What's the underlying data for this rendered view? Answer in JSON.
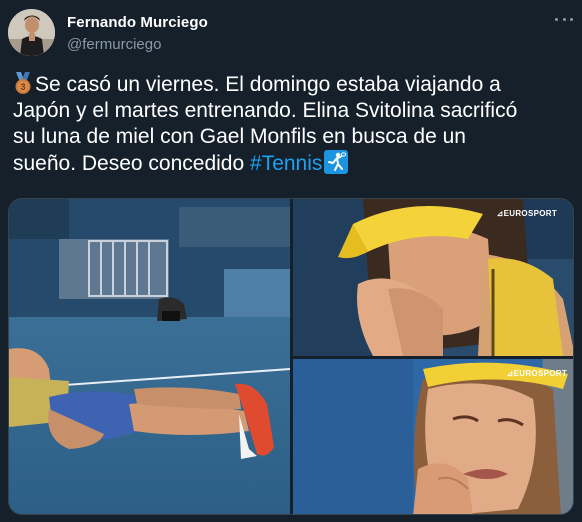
{
  "author": {
    "display_name": "Fernando Murciego",
    "handle": "@fermurciego"
  },
  "menu": {
    "icon": "more-horizontal-icon"
  },
  "tweet": {
    "medal_icon": "third-place-medal-icon",
    "lines": [
      "Se casó un viernes. El domingo estaba viajando a",
      "Japón y el martes entrenando. Elina Svitolina sacrificó",
      "su luna de miel con Gael Monfils en busca de un",
      "sueño. Deseo concedido"
    ],
    "hashtag": "#Tennis",
    "hashtag_icon": "tennis-player-icon",
    "hashtag_color": "#1da1f2"
  },
  "media": {
    "photos": [
      {
        "name": "player-lying-on-court-photo"
      },
      {
        "name": "player-crying-hands-on-face-photo",
        "watermark": "⊿EUROSPORT"
      },
      {
        "name": "player-crying-closeup-photo",
        "watermark": "⊿EUROSPORT"
      }
    ]
  },
  "colors": {
    "background": "#15202b",
    "secondary_text": "#8899a6",
    "accent": "#1da1f2"
  }
}
